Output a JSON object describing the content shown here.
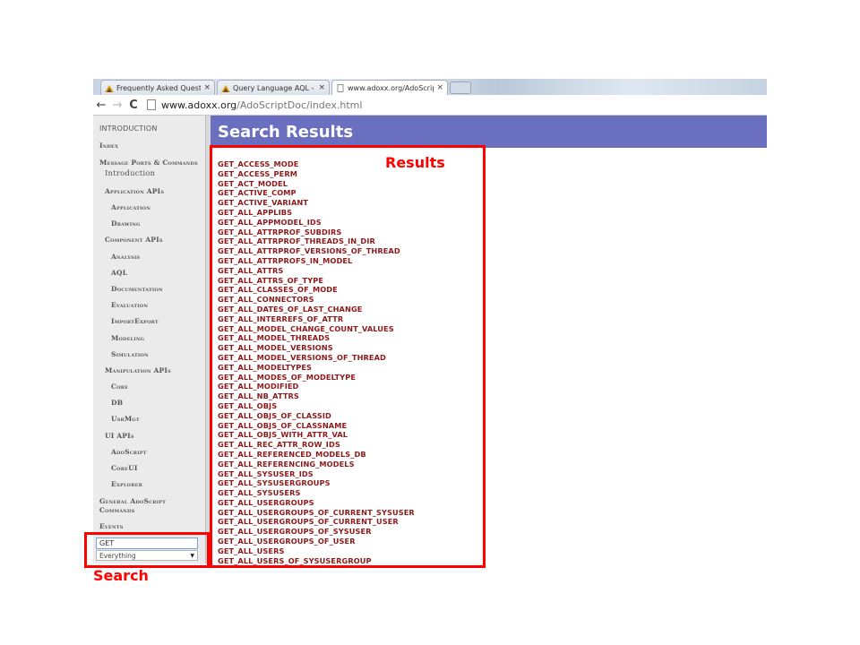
{
  "browser": {
    "tabs": [
      {
        "label": "Frequently Asked Questio",
        "icon": "adoxx-icon",
        "active": false
      },
      {
        "label": "Query Language AQL - AD",
        "icon": "adoxx-icon",
        "active": false
      },
      {
        "label": "www.adoxx.org/AdoScript",
        "icon": "page-icon",
        "active": true
      }
    ],
    "tab_close": "×",
    "back": "←",
    "forward": "→",
    "reload": "C",
    "url_host": "www.adoxx.org",
    "url_path": "/AdoScriptDoc/index.html"
  },
  "sidebar": {
    "items": [
      {
        "label": "INTRODUCTION",
        "level": "intro"
      },
      {
        "label": "Index",
        "level": "top"
      },
      {
        "label": "Message Ports & Commands",
        "level": "top"
      },
      {
        "label": "Introduction",
        "level": "l1-plain"
      },
      {
        "label": "Application APIs",
        "level": "l1"
      },
      {
        "label": "Application",
        "level": "l2"
      },
      {
        "label": "Drawing",
        "level": "l2"
      },
      {
        "label": "Component APIs",
        "level": "l1"
      },
      {
        "label": "Analysis",
        "level": "l2"
      },
      {
        "label": "AQL",
        "level": "l2"
      },
      {
        "label": "Documentation",
        "level": "l2"
      },
      {
        "label": "Evaluation",
        "level": "l2"
      },
      {
        "label": "ImportExport",
        "level": "l2"
      },
      {
        "label": "Modeling",
        "level": "l2"
      },
      {
        "label": "Simulation",
        "level": "l2"
      },
      {
        "label": "Manipulation APIs",
        "level": "l1"
      },
      {
        "label": "Core",
        "level": "l2"
      },
      {
        "label": "DB",
        "level": "l2"
      },
      {
        "label": "UsrMgt",
        "level": "l2"
      },
      {
        "label": "UI APIs",
        "level": "l1"
      },
      {
        "label": "AdoScript",
        "level": "l2"
      },
      {
        "label": "CoreUI",
        "level": "l2"
      },
      {
        "label": "Explorer",
        "level": "l2"
      },
      {
        "label": "General AdoScript Commands",
        "level": "top-wrap"
      },
      {
        "label": "Events",
        "level": "top"
      }
    ],
    "search": {
      "value": "GET",
      "scope": "Everything",
      "caret": "▼"
    }
  },
  "main": {
    "title": "Search Results",
    "results": [
      "GET_ACCESS_MODE",
      "GET_ACCESS_PERM",
      "GET_ACT_MODEL",
      "GET_ACTIVE_COMP",
      "GET_ACTIVE_VARIANT",
      "GET_ALL_APPLIBS",
      "GET_ALL_APPMODEL_IDS",
      "GET_ALL_ATTRPROF_SUBDIRS",
      "GET_ALL_ATTRPROF_THREADS_IN_DIR",
      "GET_ALL_ATTRPROF_VERSIONS_OF_THREAD",
      "GET_ALL_ATTRPROFS_IN_MODEL",
      "GET_ALL_ATTRS",
      "GET_ALL_ATTRS_OF_TYPE",
      "GET_ALL_CLASSES_OF_MODE",
      "GET_ALL_CONNECTORS",
      "GET_ALL_DATES_OF_LAST_CHANGE",
      "GET_ALL_INTERREFS_OF_ATTR",
      "GET_ALL_MODEL_CHANGE_COUNT_VALUES",
      "GET_ALL_MODEL_THREADS",
      "GET_ALL_MODEL_VERSIONS",
      "GET_ALL_MODEL_VERSIONS_OF_THREAD",
      "GET_ALL_MODELTYPES",
      "GET_ALL_MODES_OF_MODELTYPE",
      "GET_ALL_MODIFIED",
      "GET_ALL_NB_ATTRS",
      "GET_ALL_OBJS",
      "GET_ALL_OBJS_OF_CLASSID",
      "GET_ALL_OBJS_OF_CLASSNAME",
      "GET_ALL_OBJS_WITH_ATTR_VAL",
      "GET_ALL_REC_ATTR_ROW_IDS",
      "GET_ALL_REFERENCED_MODELS_DB",
      "GET_ALL_REFERENCING_MODELS",
      "GET_ALL_SYSUSER_IDS",
      "GET_ALL_SYSUSERGROUPS",
      "GET_ALL_SYSUSERS",
      "GET_ALL_USERGROUPS",
      "GET_ALL_USERGROUPS_OF_CURRENT_SYSUSER",
      "GET_ALL_USERGROUPS_OF_CURRENT_USER",
      "GET_ALL_USERGROUPS_OF_SYSUSER",
      "GET_ALL_USERGROUPS_OF_USER",
      "GET_ALL_USERS",
      "GET_ALL_USERS_OF_SYSUSERGROUP"
    ]
  },
  "annotations": {
    "results_label": "Results",
    "search_label": "Search",
    "color": "#ff0000"
  },
  "colors": {
    "banner": "#6b6fbf",
    "result_link": "#8b1a1a",
    "sidebar_bg": "#ebebeb"
  }
}
